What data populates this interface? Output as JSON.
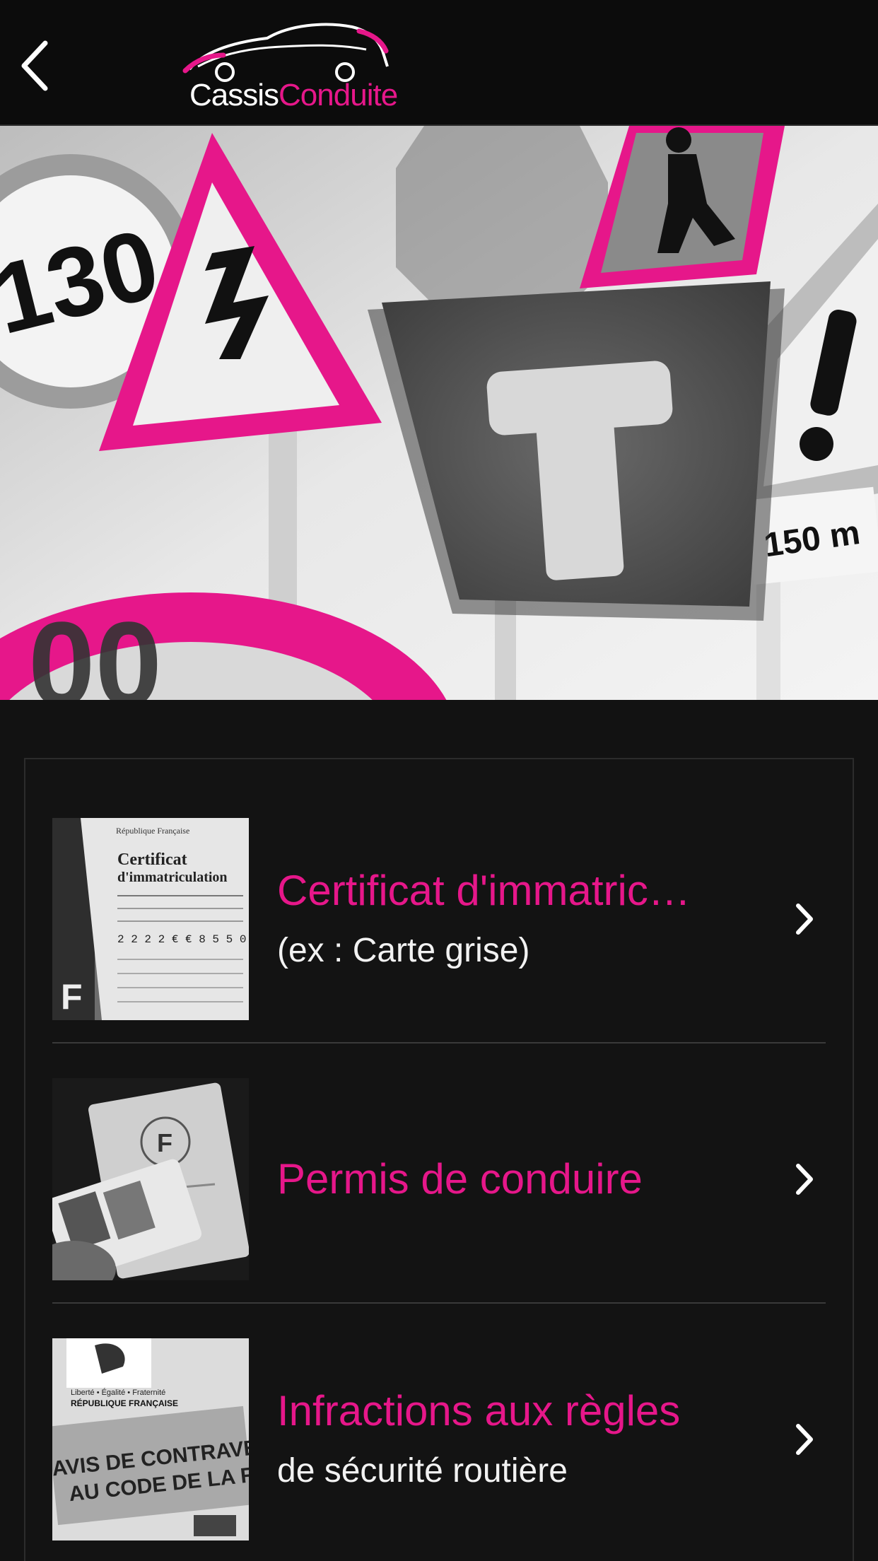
{
  "header": {
    "logo_part1": "Cassis",
    "logo_part2": "Conduite"
  },
  "hero": {
    "speed_sign_text": "130",
    "distance_plate_text": "150 m"
  },
  "menu": {
    "items": [
      {
        "title": "Certificat d'immatric…",
        "subtitle": "(ex : Carte grise)",
        "thumb": "carte-grise-image"
      },
      {
        "title": "Permis de conduire",
        "subtitle": "",
        "thumb": "permis-image"
      },
      {
        "title": "Infractions aux règles",
        "subtitle": "de sécurité routière",
        "thumb": "avis-contravention-image"
      }
    ]
  },
  "thumbs": {
    "doc1_line1": "République Française",
    "doc1_line2": "Certificat",
    "doc1_line3": "d'immatriculation",
    "doc1_number": "2 2 2 2 € € 8 5 5 0",
    "doc1_letter": "F",
    "doc2_letter": "F",
    "doc3_line1": "Liberté • Égalité • Fraternité",
    "doc3_line2": "RÉPUBLIQUE FRANÇAISE",
    "doc3_line3": "AVIS DE CONTRAVE",
    "doc3_line4": "AU CODE DE LA R"
  },
  "colors": {
    "accent": "#e6178a",
    "background": "#121212",
    "text": "#f2f2f2"
  },
  "icons": {
    "back": "chevron-left-icon",
    "row_arrow": "chevron-right-icon"
  }
}
